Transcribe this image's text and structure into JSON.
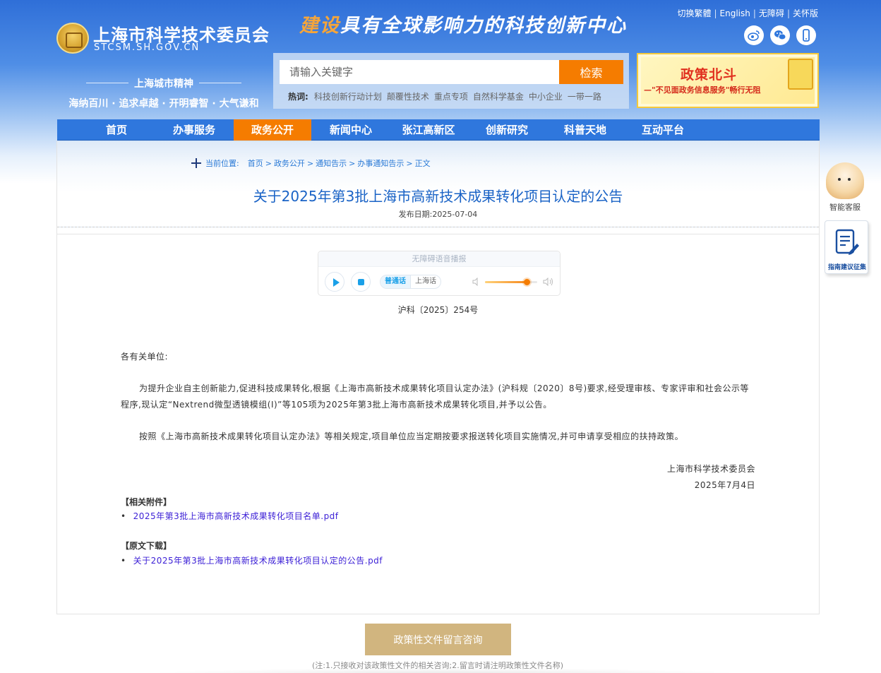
{
  "header": {
    "logo_cn": "上海市科学技术委员会",
    "logo_en": "STCSM.SH.GOV.CN",
    "spirit_title": "上海城市精神",
    "spirit_text": "海纳百川 · 追求卓越 · 开明睿智 · 大气谦和",
    "slogan_highlight": "建设",
    "slogan_rest": "具有全球影响力的科技创新中心",
    "top_links": [
      "切换繁體",
      "English",
      "无障碍",
      "关怀版"
    ],
    "social_icons": [
      "weibo-icon",
      "wechat-icon",
      "mobile-icon"
    ]
  },
  "search": {
    "placeholder": "请输入关键字",
    "button_label": "检索",
    "hot_label": "热词:",
    "hot_words": [
      "科技创新行动计划",
      "颠覆性技术",
      "重点专项",
      "自然科学基金",
      "中小企业",
      "一带一路"
    ]
  },
  "promo": {
    "title": "政策北斗",
    "subtitle": "—\"不见面政务信息服务\"畅行无阻"
  },
  "nav": {
    "items": [
      "首页",
      "办事服务",
      "政务公开",
      "新闻中心",
      "张江高新区",
      "创新研究",
      "科普天地",
      "互动平台"
    ],
    "active_index": 2
  },
  "breadcrumb": {
    "label": "当前位置:",
    "items": [
      "首页",
      "政务公开",
      "通知告示",
      "办事通知告示",
      "正文"
    ]
  },
  "article": {
    "title": "关于2025年第3批上海市高新技术成果转化项目认定的公告",
    "date": "发布日期:2025-07-04",
    "doc_no": "沪科〔2025〕254号",
    "salutation": "各有关单位:",
    "para1": "为提升企业自主创新能力,促进科技成果转化,根据《上海市高新技术成果转化项目认定办法》(沪科规〔2020〕8号)要求,经受理审核、专家评审和社会公示等程序,现认定“Nextrend微型透镜模组(Ⅰ)”等105项为2025年第3批上海市高新技术成果转化项目,并予以公告。",
    "para2": "按照《上海市高新技术成果转化项目认定办法》等相关规定,项目单位应当定期按要求报送转化项目实施情况,并可申请享受相应的扶持政策。",
    "sign_org": "上海市科学技术委员会",
    "sign_date": "2025年7月4日",
    "attachments_label": "【相关附件】",
    "attachments": [
      "2025年第3批上海市高新技术成果转化项目名单.pdf"
    ],
    "original_label": "【原文下载】",
    "originals": [
      "关于2025年第3批上海市高新技术成果转化项目认定的公告.pdf"
    ]
  },
  "player": {
    "title": "无障碍语音播报",
    "lang_options": [
      "普通话",
      "上海话"
    ],
    "selected_lang": "普通话",
    "volume": 0.8
  },
  "floating": {
    "bot_label": "智能客服",
    "guide_label": "指南建议征集"
  },
  "footer": {
    "consult_button": "政策性文件留言咨询",
    "note": "(注:1.只接收对该政策性文件的相关咨询;2.留言时请注明政策性文件名称)"
  },
  "colors": {
    "brand_blue": "#2f77dd",
    "accent_orange": "#f57c00",
    "title_blue": "#1a63c6",
    "link_purple": "#3d21d6",
    "consult_gold": "#d1b57f"
  }
}
